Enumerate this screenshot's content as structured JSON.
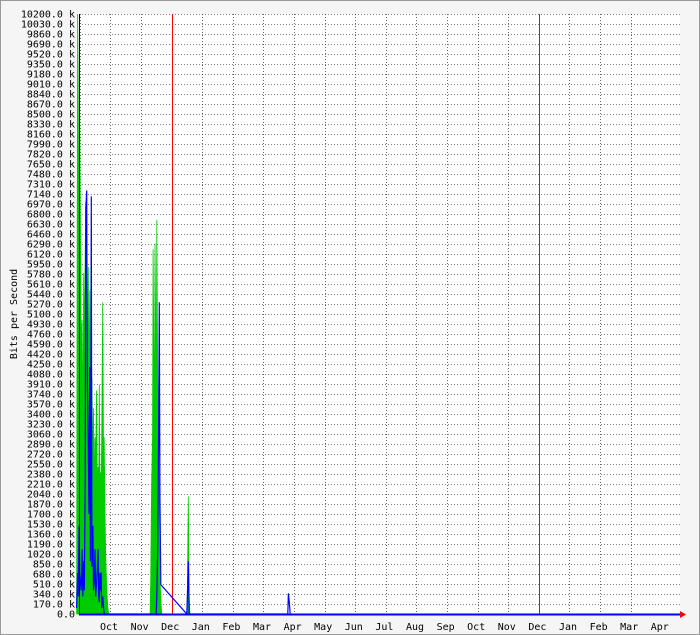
{
  "chart_data": {
    "type": "area",
    "title": "",
    "xlabel": "",
    "ylabel": "Bits per Second",
    "ylim": [
      0,
      10200
    ],
    "y_unit": "k",
    "y_ticks": [
      0,
      170,
      340,
      510,
      680,
      850,
      1020,
      1190,
      1360,
      1530,
      1700,
      1870,
      2040,
      2210,
      2380,
      2550,
      2720,
      2890,
      3060,
      3230,
      3400,
      3570,
      3740,
      3910,
      4080,
      4250,
      4420,
      4590,
      4760,
      4930,
      5100,
      5270,
      5440,
      5610,
      5780,
      5950,
      6120,
      6290,
      6460,
      6630,
      6800,
      6970,
      7140,
      7310,
      7480,
      7650,
      7820,
      7990,
      8160,
      8330,
      8500,
      8670,
      8840,
      9010,
      9180,
      9350,
      9520,
      9690,
      9860,
      10030,
      10200
    ],
    "y_tick_labels": [
      "0.0",
      "170.0 k",
      "340.0 k",
      "510.0 k",
      "680.0 k",
      "850.0 k",
      "1020.0 k",
      "1190.0 k",
      "1360.0 k",
      "1530.0 k",
      "1700.0 k",
      "1870.0 k",
      "2040.0 k",
      "2210.0 k",
      "2380.0 k",
      "2550.0 k",
      "2720.0 k",
      "2890.0 k",
      "3060.0 k",
      "3230.0 k",
      "3400.0 k",
      "3570.0 k",
      "3740.0 k",
      "3910.0 k",
      "4080.0 k",
      "4250.0 k",
      "4420.0 k",
      "4590.0 k",
      "4760.0 k",
      "4930.0 k",
      "5100.0 k",
      "5270.0 k",
      "5440.0 k",
      "5610.0 k",
      "5780.0 k",
      "5950.0 k",
      "6120.0 k",
      "6290.0 k",
      "6460.0 k",
      "6630.0 k",
      "6800.0 k",
      "6970.0 k",
      "7140.0 k",
      "7310.0 k",
      "7480.0 k",
      "7650.0 k",
      "7820.0 k",
      "7990.0 k",
      "8160.0 k",
      "8330.0 k",
      "8500.0 k",
      "8670.0 k",
      "8840.0 k",
      "9010.0 k",
      "9180.0 k",
      "9350.0 k",
      "9520.0 k",
      "9690.0 k",
      "9860.0 k",
      "10030.0 k",
      "10200.0 k"
    ],
    "months": [
      "Oct",
      "Nov",
      "Dec",
      "Jan",
      "Feb",
      "Mar",
      "Apr",
      "May",
      "Jun",
      "Jul",
      "Aug",
      "Sep",
      "Oct",
      "Nov",
      "Dec",
      "Jan",
      "Feb",
      "Mar",
      "Apr"
    ],
    "year_boundaries": [
      3,
      15
    ],
    "grid": true,
    "colors": {
      "in": "#00cc00",
      "out": "#0000ff",
      "year_line": "#ff0000",
      "grid": "#000000",
      "plot_bg": "#ffffff",
      "page_bg": "#f5f5f5"
    },
    "series": [
      {
        "key": "in",
        "x": [
          -0.6,
          -0.57,
          -0.55,
          -0.52,
          -0.5,
          -0.47,
          -0.45,
          -0.42,
          -0.4,
          -0.37,
          -0.35,
          -0.32,
          -0.3,
          -0.27,
          -0.25,
          -0.22,
          -0.2,
          -0.17,
          -0.15,
          -0.12,
          -0.1,
          -0.07,
          -0.05,
          -0.02,
          0,
          0.02,
          0.05,
          0.08,
          0.1,
          0.12,
          0.14,
          0.16,
          0.18,
          0.2,
          0.22,
          0.25,
          0.28,
          0.3,
          0.32,
          0.35,
          0.38,
          0.4,
          0.42,
          0.45,
          1.8,
          1.82,
          1.85,
          1.88,
          1.9,
          1.92,
          1.94,
          1.96,
          1.98,
          2.0,
          2.02,
          2.05,
          2.08,
          2.1,
          2.12,
          2.15,
          2.18,
          2.2,
          2.22,
          2.25,
          2.28,
          2.3,
          2.32,
          2.35,
          2.38,
          2.4,
          2.42,
          2.45,
          3.0,
          3.02,
          3.05,
          3.08,
          3.1
        ],
        "values": [
          300,
          10200,
          9000,
          5500,
          8500,
          6000,
          4500,
          5000,
          3000,
          5800,
          4500,
          6200,
          7000,
          4000,
          3200,
          5900,
          3800,
          5500,
          3000,
          4000,
          4000,
          2500,
          3500,
          2000,
          3000,
          2500,
          3800,
          2000,
          2500,
          2000,
          3900,
          2400,
          2400,
          2000,
          3000,
          5300,
          2500,
          3000,
          2000,
          1000,
          500,
          300,
          100,
          0,
          0,
          600,
          2200,
          3000,
          6200,
          4500,
          3000,
          6300,
          5200,
          3000,
          6700,
          4000,
          3000,
          1500,
          600,
          300,
          0,
          0,
          0,
          0,
          0,
          0,
          0,
          0,
          0,
          0,
          0,
          0,
          0,
          400,
          2000,
          300,
          0
        ]
      },
      {
        "key": "out",
        "x": [
          -0.6,
          -0.57,
          -0.55,
          -0.52,
          -0.5,
          -0.47,
          -0.45,
          -0.42,
          -0.4,
          -0.37,
          -0.35,
          -0.32,
          -0.3,
          -0.27,
          -0.25,
          -0.22,
          -0.2,
          -0.17,
          -0.15,
          -0.12,
          -0.1,
          -0.07,
          -0.05,
          -0.02,
          0,
          0.02,
          0.05,
          0.08,
          0.1,
          0.12,
          0.14,
          0.16,
          0.18,
          0.2,
          0.22,
          0.25,
          0.28,
          0.3,
          2.0,
          2.02,
          2.05,
          2.08,
          2.1,
          2.12,
          2.15,
          3.0,
          3.02,
          3.05,
          3.08,
          6.3,
          6.32,
          6.35,
          6.38
        ],
        "values": [
          100,
          700,
          300,
          1500,
          700,
          500,
          400,
          1100,
          300,
          900,
          400,
          2300,
          6900,
          7200,
          4000,
          2900,
          1700,
          4200,
          900,
          7100,
          800,
          1500,
          400,
          600,
          1100,
          300,
          500,
          800,
          1100,
          300,
          200,
          700,
          400,
          700,
          100,
          300,
          100,
          0,
          0,
          300,
          1100,
          3000,
          5300,
          2000,
          500,
          0,
          300,
          900,
          0,
          0,
          350,
          200,
          0
        ]
      }
    ]
  }
}
